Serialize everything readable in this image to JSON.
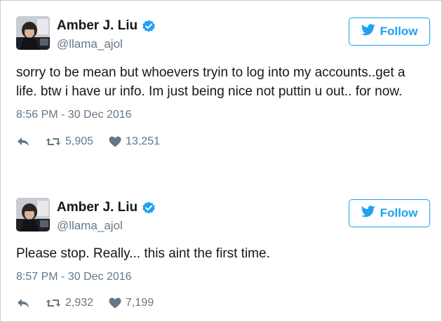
{
  "tweets": [
    {
      "name": "Amber J. Liu",
      "handle": "@llama_ajol",
      "follow_label": "Follow",
      "text": "sorry to be mean but whoevers tryin to log into my accounts..get a life. btw i have ur info. Im just being nice not puttin u out.. for now.",
      "timestamp": "8:56 PM - 30 Dec 2016",
      "retweets": "5,905",
      "likes": "13,251"
    },
    {
      "name": "Amber J. Liu",
      "handle": "@llama_ajol",
      "follow_label": "Follow",
      "text": "Please stop. Really... this aint the first time.",
      "timestamp": "8:57 PM - 30 Dec 2016",
      "retweets": "2,932",
      "likes": "7,199"
    }
  ],
  "icons": {
    "verified": "verified-badge-icon",
    "follow": "bird-icon",
    "reply": "reply-icon",
    "retweet": "retweet-icon",
    "like": "heart-icon"
  },
  "colors": {
    "accent": "#1da1f2",
    "muted": "#657786",
    "text": "#14171a"
  }
}
